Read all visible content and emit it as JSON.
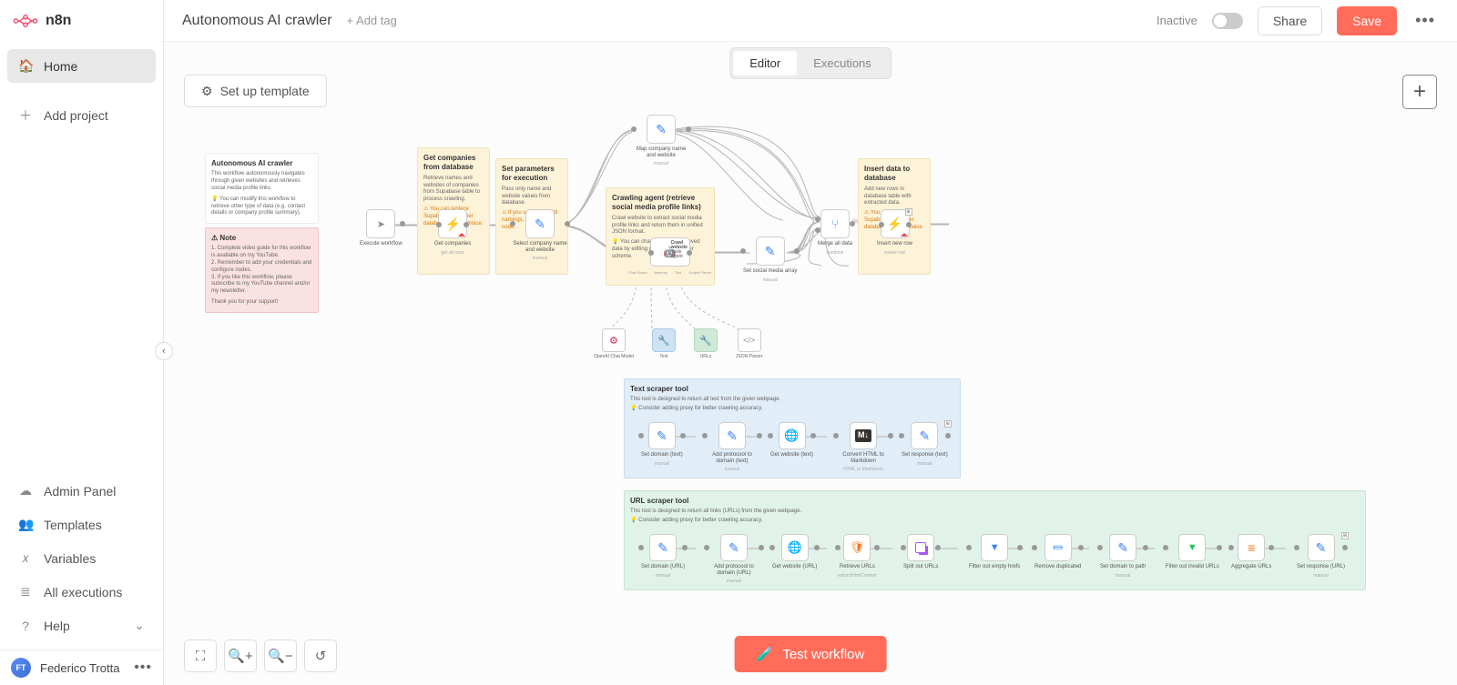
{
  "app": {
    "logo_text": "n8n"
  },
  "sidebar": {
    "home": "Home",
    "add_project": "Add project",
    "admin_panel": "Admin Panel",
    "templates": "Templates",
    "variables": "Variables",
    "executions": "All executions",
    "help": "Help"
  },
  "user": {
    "initials": "FT",
    "name": "Federico Trotta"
  },
  "topbar": {
    "title": "Autonomous AI crawler",
    "add_tag": "+ Add tag",
    "inactive": "Inactive",
    "share": "Share",
    "save": "Save"
  },
  "tabs": {
    "editor": "Editor",
    "executions": "Executions"
  },
  "canvas": {
    "setup_template": "Set up template",
    "test_workflow": "Test workflow",
    "add_node": "+"
  },
  "stickies": {
    "intro": {
      "title": "Autonomous AI crawler",
      "p1": "This workflow autonomously navigates through given websites and retrieves social media profile links.",
      "p2": "💡 You can modify this workflow to retrieve other type of data (e.g. contact details or company profile summary)."
    },
    "note": {
      "title": "⚠ Note",
      "l1": "1. Complete video guide for this workflow is available on my YouTube.",
      "l2": "2. Remember to add your credentials and configure nodes.",
      "l3": "3. If you like this workflow, please subscribe to my YouTube channel and/or my newsletter.",
      "thanks": "Thank you for your support!"
    },
    "get_companies": {
      "title": "Get companies from database",
      "p1": "Retrieve names and websites of companies from Supabase table to process crawling.",
      "p2": "⚠ You can replace Supabase with other database of your choice."
    },
    "params": {
      "title": "Set parameters for execution",
      "p1": "Pass only name and website values from database.",
      "p2": "⚠ If you use other field namings, update this node."
    },
    "agent": {
      "title": "Crawling agent (retrieve social media profile links)",
      "p1": "Crawl website to extract social media profile links and return them in unified JSON format.",
      "p2": "💡 You can change type of retrieved data by editing prompt and parser scheme."
    },
    "insert": {
      "title": "Insert data to database",
      "p1": "Add new rows in database table with extracted data.",
      "p2": "⚠ You can replace Supabase with other database of your choice."
    },
    "text_tool": {
      "title": "Text scraper tool",
      "p1": "This tool is designed to return all text from the given webpage.",
      "p2": "💡 Consider adding proxy for better crawling accuracy."
    },
    "url_tool": {
      "title": "URL scraper tool",
      "p1": "This tool is designed to return all links (URLs) from the given webpage.",
      "p2": "💡 Consider adding proxy for better crawling accuracy."
    }
  },
  "nodes": {
    "execute": "Execute workflow",
    "get_companies": "Get companies",
    "get_companies_sub": "get all rows",
    "select_company": "Select company name and website",
    "manual": "manual",
    "map_company": "Map company name and website",
    "crawl_website": "Crawl website",
    "crawl_sub": "Tools Agent",
    "set_social": "Set social media array",
    "merge": "Merge all data",
    "merge_sub": "combine",
    "insert": "Insert new row",
    "insert_sub": "create row",
    "openai": "OpenAI Chat Model",
    "text": "Text",
    "urls": "URLs",
    "json_parser": "JSON Parser",
    "agent_ports": {
      "chat": "Chat Model",
      "memory": "Memory",
      "tool": "Tool",
      "output": "Output Parser"
    },
    "set_domain_text": "Set domain (text)",
    "add_proto_text": "Add protocool to domain (text)",
    "get_website_text": "Get website (text)",
    "convert_md": "Convert HTML to Markdown",
    "convert_md_sub": "HTML to Markdown",
    "set_response_text": "Set response (text)",
    "set_domain_url": "Set domain (URL)",
    "add_proto_url": "Add protocool to domain (URL)",
    "get_website_url": "Get website (URL)",
    "retrieve_urls": "Retrieve URLs",
    "retrieve_urls_sub": "extractHtmlContent",
    "split_urls": "Split out URLs",
    "filter_empty": "Filter out empty hrefs",
    "remove_dup": "Remove duplicated",
    "set_domain_path": "Set domain to path",
    "filter_invalid": "Filter out invalid URLs",
    "aggregate": "Aggregate URLs",
    "set_response_url": "Set response (URL)"
  }
}
